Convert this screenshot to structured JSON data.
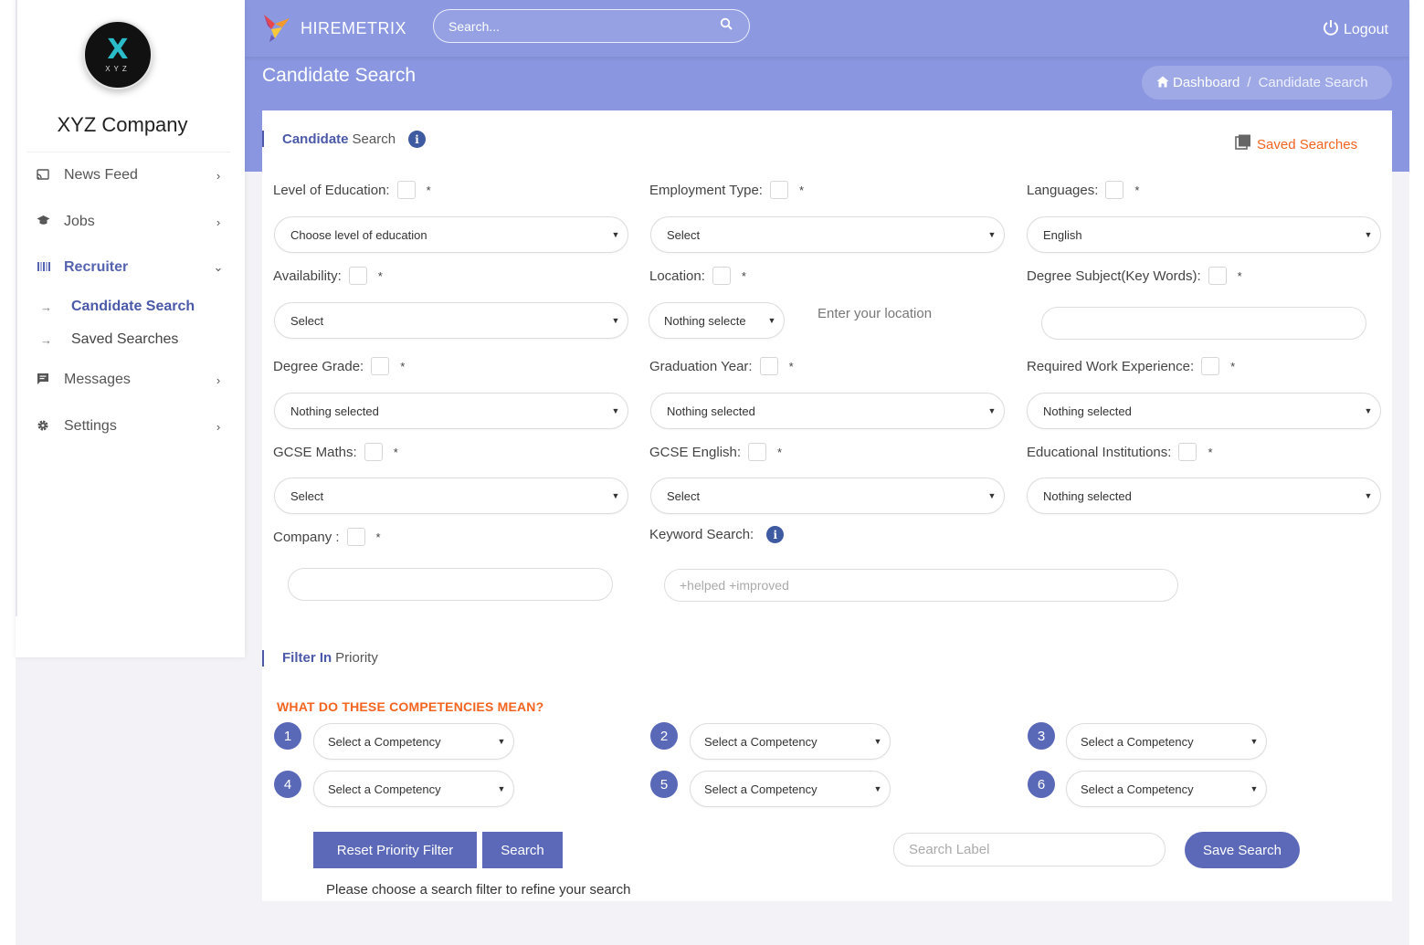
{
  "colors": {
    "primary": "#5b69b8",
    "topbar": "#8a97e0",
    "accent_orange": "#f2641f"
  },
  "sidebar": {
    "logo_text": "X",
    "logo_sub": "XYZ",
    "company": "XYZ Company",
    "items": [
      {
        "label": "News Feed",
        "icon": "rss-icon"
      },
      {
        "label": "Jobs",
        "icon": "graduation-cap-icon"
      },
      {
        "label": "Recruiter",
        "icon": "barcode-icon"
      },
      {
        "label": "Messages",
        "icon": "chat-icon"
      },
      {
        "label": "Settings",
        "icon": "gear-icon"
      }
    ],
    "sub_items": [
      {
        "label": "Candidate Search"
      },
      {
        "label": "Saved Searches"
      }
    ]
  },
  "header": {
    "brand": "HIREMETRIX",
    "search_placeholder": "Search...",
    "logout": "Logout",
    "page_title": "Candidate Search",
    "breadcrumb": [
      "Dashboard",
      "Candidate Search"
    ]
  },
  "card": {
    "title_strong": "Candidate",
    "title_rest": "Search",
    "saved_searches": "Saved Searches",
    "fields": {
      "level_of_education": {
        "label": "Level of Education:",
        "value": "Choose level of education"
      },
      "employment_type": {
        "label": "Employment Type:",
        "value": "Select"
      },
      "languages": {
        "label": "Languages:",
        "value": "English"
      },
      "availability": {
        "label": "Availability:",
        "value": "Select"
      },
      "location": {
        "label": "Location:",
        "value": "Nothing selecte",
        "hint": "Enter your location"
      },
      "degree_subject": {
        "label": "Degree Subject(Key Words):",
        "value": ""
      },
      "degree_grade": {
        "label": "Degree Grade:",
        "value": "Nothing selected"
      },
      "graduation_year": {
        "label": "Graduation Year:",
        "value": "Nothing selected"
      },
      "work_experience": {
        "label": "Required Work Experience:",
        "value": "Nothing selected"
      },
      "gcse_maths": {
        "label": "GCSE Maths:",
        "value": "Select"
      },
      "gcse_english": {
        "label": "GCSE English:",
        "value": "Select"
      },
      "institutions": {
        "label": "Educational Institutions:",
        "value": "Nothing selected"
      },
      "company": {
        "label": "Company :",
        "value": ""
      },
      "keyword": {
        "label": "Keyword Search:",
        "placeholder": "+helped +improved"
      }
    },
    "required_mark": "*",
    "filter_strong": "Filter In",
    "filter_rest": "Priority",
    "competency_link": "WHAT DO THESE COMPETENCIES MEAN?",
    "competencies": [
      {
        "num": "1",
        "value": "Select a Competency"
      },
      {
        "num": "2",
        "value": "Select a Competency"
      },
      {
        "num": "3",
        "value": "Select a Competency"
      },
      {
        "num": "4",
        "value": "Select a Competency"
      },
      {
        "num": "5",
        "value": "Select a Competency"
      },
      {
        "num": "6",
        "value": "Select a Competency"
      }
    ],
    "reset_button": "Reset Priority Filter",
    "search_button": "Search",
    "search_label_placeholder": "Search Label",
    "save_button": "Save Search",
    "hint": "Please choose a search filter to refine your search"
  }
}
